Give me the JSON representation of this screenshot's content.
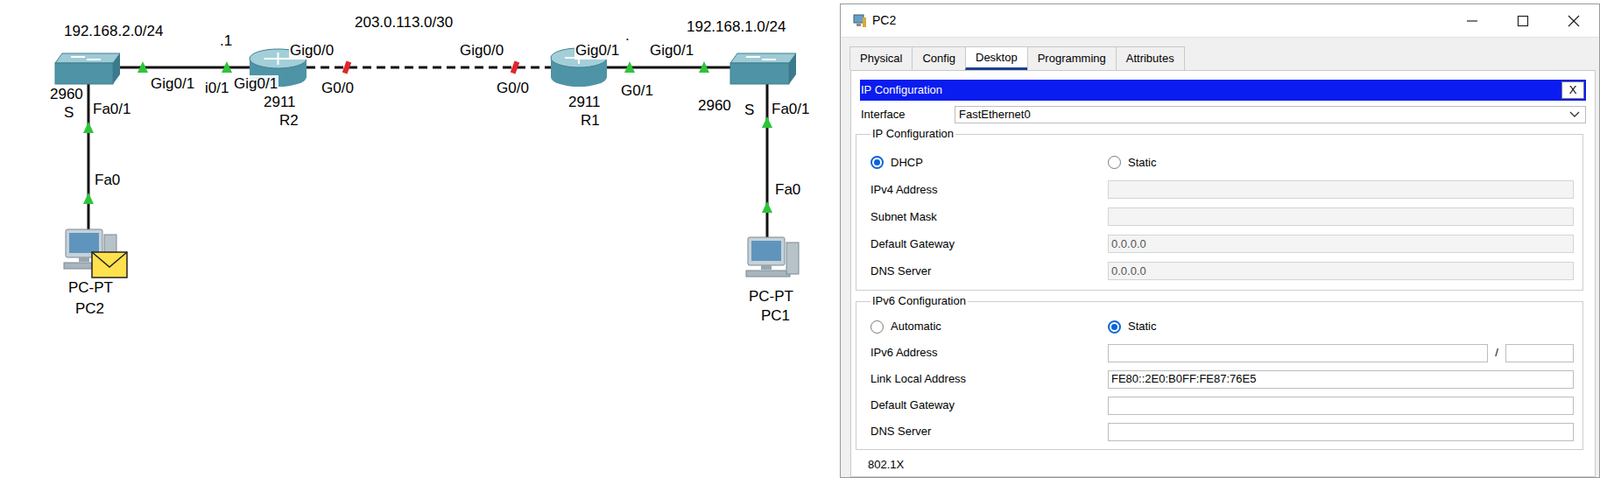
{
  "diagram": {
    "labels": [
      {
        "text": "192.168.2.0/24"
      },
      {
        "text": ".1"
      },
      {
        "text": "Gig0/0"
      },
      {
        "text": "203.0.113.0/30"
      },
      {
        "text": "Gig0/0"
      },
      {
        "text": "Gig0/1"
      },
      {
        "text": "."
      },
      {
        "text": "Gig0/1"
      },
      {
        "text": "192.168.1.0/24"
      },
      {
        "text": "Gig0/1"
      },
      {
        "text": "i0/1"
      },
      {
        "text": "Gig0/1"
      },
      {
        "text": "G0/0"
      },
      {
        "text": "G0/0"
      },
      {
        "text": "G0/1"
      },
      {
        "text": "2960"
      },
      {
        "text": "S"
      },
      {
        "text": "Fa0/1"
      },
      {
        "text": "2911"
      },
      {
        "text": "R2"
      },
      {
        "text": "2911"
      },
      {
        "text": "R1"
      },
      {
        "text": "2960"
      },
      {
        "text": "S"
      },
      {
        "text": "Fa0/1"
      },
      {
        "text": "Fa0"
      },
      {
        "text": "Fa0"
      },
      {
        "text": "PC-PT"
      },
      {
        "text": "PC2"
      },
      {
        "text": "PC-PT"
      },
      {
        "text": "PC1"
      }
    ],
    "devices": [
      {
        "kind": "switch",
        "pdu": false
      },
      {
        "kind": "router",
        "pdu": false
      },
      {
        "kind": "router",
        "pdu": false
      },
      {
        "kind": "switch",
        "pdu": false
      },
      {
        "kind": "pc",
        "pdu": true
      },
      {
        "kind": "pc",
        "pdu": false
      }
    ],
    "links": [
      {
        "kind": "solid",
        "end_a_up": true,
        "end_b_up": true
      },
      {
        "kind": "dashed",
        "end_a_up": false,
        "end_b_up": false
      },
      {
        "kind": "solid",
        "end_a_up": true,
        "end_b_up": true
      },
      {
        "kind": "solid",
        "end_a_up": true,
        "end_b_up": true
      },
      {
        "kind": "solid",
        "end_a_up": true,
        "end_b_up": true
      }
    ]
  },
  "window": {
    "title": "PC2"
  },
  "tabs": [
    {
      "label": "Physical",
      "selected": false
    },
    {
      "label": "Config",
      "selected": false
    },
    {
      "label": "Desktop",
      "selected": true
    },
    {
      "label": "Programming",
      "selected": false
    },
    {
      "label": "Attributes",
      "selected": false
    }
  ],
  "ip_config": {
    "title": "IP Configuration",
    "close": "X",
    "interface_label": "Interface",
    "interface_value": "FastEthernet0",
    "ipv4": {
      "legend": "IP Configuration",
      "modes": [
        {
          "label": "DHCP",
          "selected": true
        },
        {
          "label": "Static",
          "selected": false
        }
      ],
      "fields": [
        {
          "kind": "plain",
          "label": "IPv4 Address",
          "value": "",
          "disabled": true
        },
        {
          "kind": "plain",
          "label": "Subnet Mask",
          "value": "",
          "disabled": true
        },
        {
          "kind": "plain",
          "label": "Default Gateway",
          "value": "0.0.0.0",
          "disabled": true
        },
        {
          "kind": "plain",
          "label": "DNS Server",
          "value": "0.0.0.0",
          "disabled": true
        }
      ]
    },
    "ipv6": {
      "legend": "IPv6 Configuration",
      "modes": [
        {
          "label": "Automatic",
          "selected": false
        },
        {
          "label": "Static",
          "selected": true
        }
      ],
      "fields": [
        {
          "kind": "prefixed",
          "label": "IPv6 Address",
          "value": "",
          "separator": "/",
          "prefix": "",
          "disabled": false
        },
        {
          "kind": "plain",
          "label": "Link Local Address",
          "value": "FE80::2E0:B0FF:FE87:76E5",
          "disabled": false
        },
        {
          "kind": "plain",
          "label": "Default Gateway",
          "value": "",
          "disabled": false
        },
        {
          "kind": "plain",
          "label": "DNS Server",
          "value": "",
          "disabled": false
        }
      ]
    },
    "next_section": "802.1X"
  }
}
